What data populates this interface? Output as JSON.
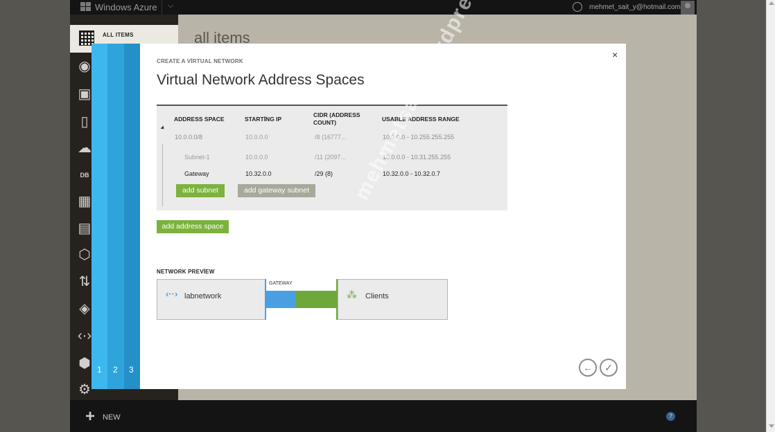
{
  "topbar": {
    "brand": "Windows Azure",
    "email": "mehmet_sait_y@hotmail.com"
  },
  "sidenav": {
    "all_items_label": "ALL ITEMS",
    "db_label": "DB"
  },
  "page": {
    "title": "all items"
  },
  "bottombar": {
    "new_label": "NEW",
    "plus_glyph": "+",
    "help_glyph": "?"
  },
  "wizard": {
    "eyebrow": "CREATE A VİRTUAL NETWORK",
    "title": "Virtual Network Address Spaces",
    "close_glyph": "×",
    "steps": [
      "1",
      "2",
      "3"
    ],
    "table": {
      "headers": {
        "address_space": "ADDRESS SPACE",
        "starting_ip": "STARTİNG IP",
        "cidr_line1": "CIDR (ADDRESS",
        "cidr_line2": "COUNT)",
        "usable": "USABLE ADDRESS RANGE"
      },
      "address_space": {
        "name": "10.0.0.0/8",
        "starting_ip": "10.0.0.0",
        "cidr": "/8 (16777...",
        "usable": "10.0.0.0 - 10.255.255.255"
      },
      "subnets": [
        {
          "name": "Subnet-1",
          "starting_ip": "10.0.0.0",
          "cidr": "/11 (2097...",
          "usable": "10.0.0.0 - 10.31.255.255"
        },
        {
          "name": "Gateway",
          "starting_ip": "10.32.0.0",
          "cidr": "/29 (8)",
          "usable": "10.32.0.0 - 10.32.0.7"
        }
      ],
      "add_subnet_label": "add subnet",
      "add_gateway_subnet_label": "add gateway subnet"
    },
    "add_address_space_label": "add address space",
    "preview": {
      "label": "NETWORK PREVİEW",
      "network_name": "labnetwork",
      "gateway_label": "GATEWAY",
      "clients_label": "Clients"
    },
    "back_glyph": "←",
    "finish_glyph": "✓"
  },
  "watermark": "mehmetsait.wordpress.com",
  "colors": {
    "accent_green": "#7cb23d",
    "step_blue": "#3db8ee",
    "gateway_blue": "#4a9fe3",
    "gateway_green": "#6fa83a"
  }
}
